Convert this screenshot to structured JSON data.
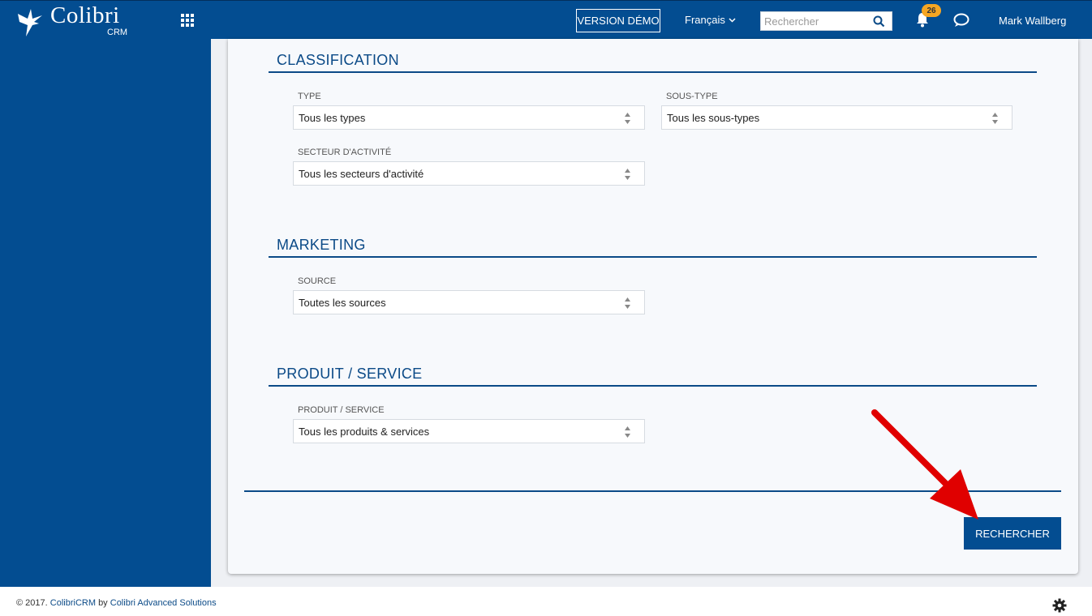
{
  "header": {
    "logo_name": "Colibri",
    "logo_sub": "CRM",
    "demo_label": "VERSION DÉMO",
    "language": "Français",
    "search_placeholder": "Rechercher",
    "notifications_count": "26",
    "user_name": "Mark Wallberg",
    "icons": [
      "colibri-logo-icon",
      "apps-grid-icon",
      "chevron-down-icon",
      "search-icon",
      "bell-icon",
      "chat-icon"
    ]
  },
  "sections": {
    "classification": {
      "title": "CLASSIFICATION",
      "type_label": "TYPE",
      "type_value": "Tous les types",
      "subtype_label": "SOUS-TYPE",
      "subtype_value": "Tous les sous-types",
      "sector_label": "SECTEUR D'ACTIVITÉ",
      "sector_value": "Tous les secteurs d'activité"
    },
    "marketing": {
      "title": "MARKETING",
      "source_label": "SOURCE",
      "source_value": "Toutes les sources"
    },
    "product": {
      "title": "PRODUIT / SERVICE",
      "product_label": "PRODUIT / SERVICE",
      "product_value": "Tous les produits & services"
    }
  },
  "actions": {
    "search_button": "RECHERCHER"
  },
  "footer": {
    "copyright": "© 2017.",
    "brand_link": "ColibriCRM",
    "by": "by",
    "company_link": "Colibri Advanced Solutions",
    "icon": "gear-icon"
  },
  "colors": {
    "primary": "#034d91",
    "accent_badge": "#f5a623",
    "annotation_arrow": "#e00000"
  }
}
